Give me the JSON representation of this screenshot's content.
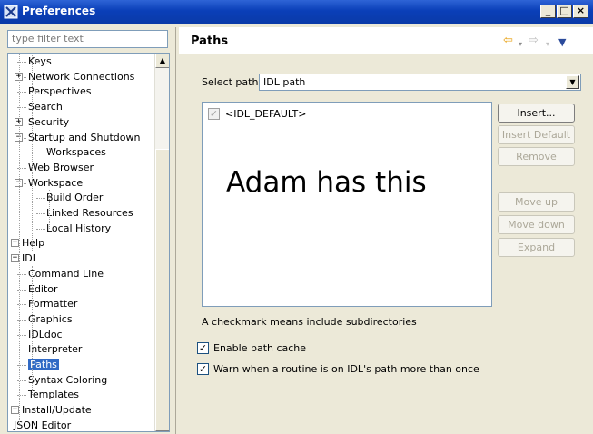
{
  "window": {
    "title": "Preferences"
  },
  "filter": {
    "placeholder": "type filter text"
  },
  "tree": [
    {
      "label": "Keys",
      "depth": 2,
      "expander": ""
    },
    {
      "label": "Network Connections",
      "depth": 2,
      "expander": "+"
    },
    {
      "label": "Perspectives",
      "depth": 2,
      "expander": ""
    },
    {
      "label": "Search",
      "depth": 2,
      "expander": ""
    },
    {
      "label": "Security",
      "depth": 2,
      "expander": "+"
    },
    {
      "label": "Startup and Shutdown",
      "depth": 2,
      "expander": "-"
    },
    {
      "label": "Workspaces",
      "depth": 3,
      "expander": ""
    },
    {
      "label": "Web Browser",
      "depth": 2,
      "expander": ""
    },
    {
      "label": "Workspace",
      "depth": 2,
      "expander": "-"
    },
    {
      "label": "Build Order",
      "depth": 3,
      "expander": ""
    },
    {
      "label": "Linked Resources",
      "depth": 3,
      "expander": ""
    },
    {
      "label": "Local History",
      "depth": 3,
      "expander": ""
    },
    {
      "label": "Help",
      "depth": 1,
      "expander": "+"
    },
    {
      "label": "IDL",
      "depth": 1,
      "expander": "-"
    },
    {
      "label": "Command Line",
      "depth": 2,
      "expander": ""
    },
    {
      "label": "Editor",
      "depth": 2,
      "expander": ""
    },
    {
      "label": "Formatter",
      "depth": 2,
      "expander": ""
    },
    {
      "label": "Graphics",
      "depth": 2,
      "expander": ""
    },
    {
      "label": "IDLdoc",
      "depth": 2,
      "expander": ""
    },
    {
      "label": "Interpreter",
      "depth": 2,
      "expander": ""
    },
    {
      "label": "Paths",
      "depth": 2,
      "expander": "",
      "selected": true
    },
    {
      "label": "Syntax Coloring",
      "depth": 2,
      "expander": ""
    },
    {
      "label": "Templates",
      "depth": 2,
      "expander": ""
    },
    {
      "label": "Install/Update",
      "depth": 1,
      "expander": "+"
    },
    {
      "label": "JSON Editor",
      "depth": 1,
      "expander": ""
    }
  ],
  "page": {
    "title": "Paths",
    "select_label": "Select path",
    "select_value": "IDL path",
    "path_item": "<IDL_DEFAULT>",
    "overlay_text": "Adam has this",
    "buttons": {
      "insert": "Insert...",
      "insert_default": "Insert Default",
      "remove": "Remove",
      "move_up": "Move up",
      "move_down": "Move down",
      "expand": "Expand"
    },
    "info_text": "A checkmark means include subdirectories",
    "enable_cache_label": "Enable path cache",
    "enable_cache_checked": true,
    "warn_label": "Warn when a routine is on IDL's path more than once",
    "warn_checked": true
  },
  "colors": {
    "titlebar": "#0a3fb8",
    "selection": "#316ac5",
    "accent_arrow": "#e8a317"
  }
}
